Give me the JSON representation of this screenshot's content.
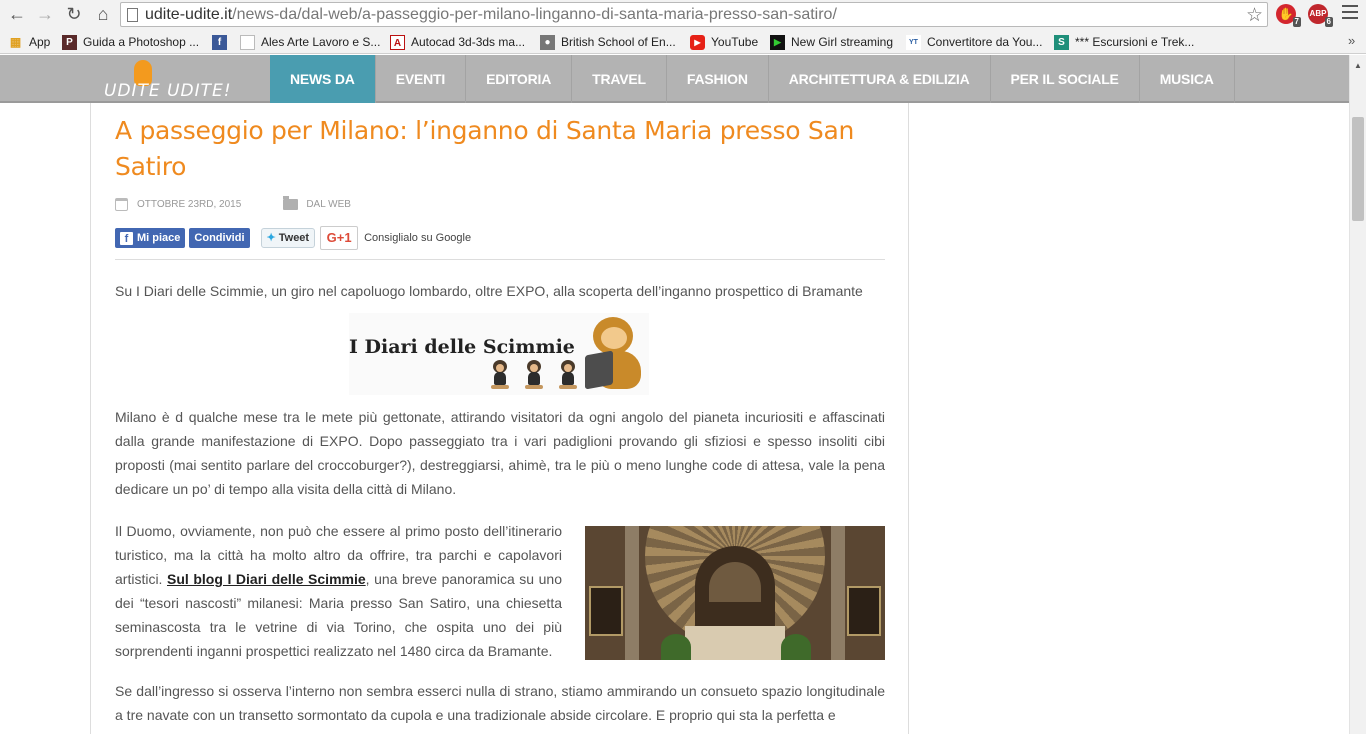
{
  "browser": {
    "url_domain": "udite-udite.it",
    "url_path": "/news-da/dal-web/a-passeggio-per-milano-linganno-di-santa-maria-presso-san-satiro/",
    "extensions": [
      {
        "name": "adblock-plus",
        "badge": "6",
        "label": "ABP",
        "color": "#c0272d"
      },
      {
        "name": "adblock",
        "badge": "7",
        "label": "✋",
        "color": "#d3262e"
      }
    ]
  },
  "bookmarks": [
    {
      "label": "App",
      "icon": "apps-grid-icon",
      "color": "#e0a020"
    },
    {
      "label": "Guida a Photoshop ...",
      "icon": "photoshop-icon",
      "color": "#5a2a2a"
    },
    {
      "label": "",
      "icon": "facebook-icon",
      "color": "#3b5998"
    },
    {
      "label": "Ales Arte Lavoro e S...",
      "icon": "page-icon",
      "color": "#bbbbbb"
    },
    {
      "label": "Autocad 3d-3ds ma...",
      "icon": "autocad-icon",
      "color": "#ffffff"
    },
    {
      "label": "British School of En...",
      "icon": "british-school-icon",
      "color": "#666666"
    },
    {
      "label": "YouTube",
      "icon": "youtube-icon",
      "color": "#e62117"
    },
    {
      "label": "New Girl streaming",
      "icon": "streaming-icon",
      "color": "#111111"
    },
    {
      "label": "Convertitore da You...",
      "icon": "converter-icon",
      "color": "#2b5fa3"
    },
    {
      "label": "*** Escursioni e Trek...",
      "icon": "trekking-icon",
      "color": "#1f8f7a"
    }
  ],
  "site": {
    "logo_text": "UDITE UDITE!",
    "menu": [
      "NEWS DA",
      "EVENTI",
      "EDITORIA",
      "TRAVEL",
      "FASHION",
      "ARCHITETTURA & EDILIZIA",
      "PER IL SOCIALE",
      "MUSICA"
    ],
    "active_menu_index": 0
  },
  "article": {
    "title": "A passeggio per Milano: l’inganno di Santa Maria presso San Satiro",
    "date": "OTTOBRE 23RD, 2015",
    "category": "DAL WEB",
    "share": {
      "fb_like": "Mi piace",
      "fb_share": "Condividi",
      "tweet": "Tweet",
      "gplus": "G+1",
      "gplus_label": "Consiglialo su Google"
    },
    "intro": "Su I Diari delle Scimmie, un giro nel capoluogo lombardo, oltre EXPO, alla scoperta dell’inganno prospettico di Bramante",
    "banner_text": "I Diari delle Scimmie",
    "paragraph_1": "Milano è d qualche mese tra le mete più gettonate, attirando visitatori da ogni angolo del pianeta incuriositi e affascinati dalla grande manifestazione di EXPO. Dopo passeggiato tra i vari padiglioni provando gli sfiziosi e spesso insoliti cibi proposti (mai sentito parlare del croccoburger?), destreggiarsi, ahimè, tra le più o meno lunghe code di attesa, vale la pena dedicare un po’ di tempo alla visita della città di Milano.",
    "paragraph_2_a": "Il Duomo, ovviamente, non può che essere al primo posto dell’itinerario turistico, ma la città ha molto altro da offrire, tra parchi e capolavori artistici. ",
    "paragraph_2_link": "Sul blog I Diari delle Scimmie",
    "paragraph_2_b": ", una breve panoramica su uno dei “tesori nascosti” milanesi: Maria presso San Satiro, una chiesetta seminascosta tra le vetrine di via Torino, che ospita uno dei più sorprendenti inganni prospettici realizzato nel 1480 circa da Bramante.",
    "paragraph_3": "Se dall’ingresso si osserva l’interno non sembra esserci nulla di strano, stiamo ammirando un consueto spazio longitudinale a tre navate con un transetto sormontato da cupola e una tradizionale abside circolare. E proprio qui sta la perfetta e"
  }
}
